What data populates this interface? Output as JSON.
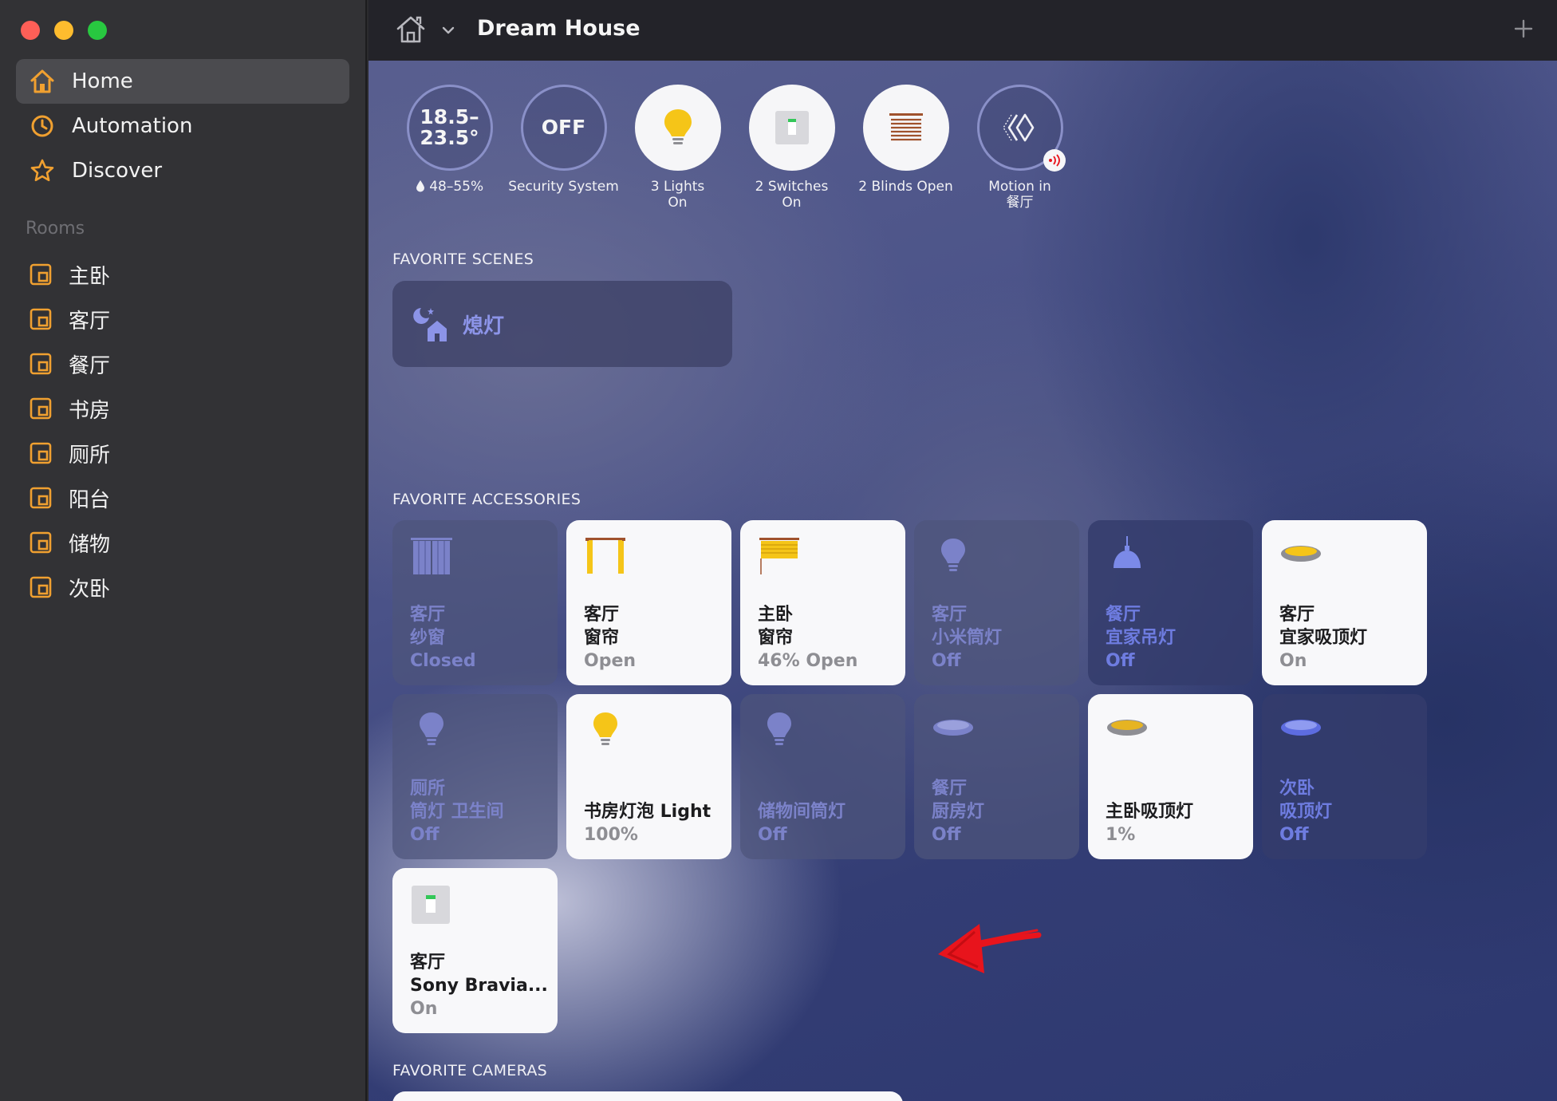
{
  "sidebar": {
    "nav": [
      {
        "label": "Home",
        "icon": "house-icon"
      },
      {
        "label": "Automation",
        "icon": "clock-icon"
      },
      {
        "label": "Discover",
        "icon": "star-icon"
      }
    ],
    "rooms_header": "Rooms",
    "rooms": [
      "主卧",
      "客厅",
      "餐厅",
      "书房",
      "厕所",
      "阳台",
      "储物",
      "次卧"
    ]
  },
  "titlebar": {
    "title": "Dream House"
  },
  "status": {
    "climate": {
      "value": "18.5–\n23.5°",
      "label": "48–55%"
    },
    "security": {
      "value": "OFF",
      "label": "Security System"
    },
    "lights": {
      "label": "3 Lights\nOn"
    },
    "switches": {
      "label": "2 Switches\nOn"
    },
    "blinds": {
      "label": "2 Blinds Open"
    },
    "motion": {
      "label": "Motion in\n餐厅"
    }
  },
  "scenes": {
    "header": "FAVORITE SCENES",
    "items": [
      {
        "label": "熄灯"
      }
    ]
  },
  "accessories": {
    "header": "FAVORITE ACCESSORIES",
    "tiles": [
      {
        "name": "客厅\n纱窗",
        "state": "Closed",
        "on": false,
        "icon": "curtain-closed-icon"
      },
      {
        "name": "客厅\n窗帘",
        "state": "Open",
        "on": true,
        "icon": "curtain-open-icon"
      },
      {
        "name": "主卧\n窗帘",
        "state": "46% Open",
        "on": true,
        "icon": "blinds-icon"
      },
      {
        "name": "客厅\n小米筒灯",
        "state": "Off",
        "on": false,
        "icon": "bulb-icon"
      },
      {
        "name": "餐厅\n宜家吊灯",
        "state": "Off",
        "on": false,
        "icon": "pendant-lamp-icon"
      },
      {
        "name": "客厅\n宜家吸顶灯",
        "state": "On",
        "on": true,
        "icon": "ceiling-light-icon"
      },
      {
        "name": "厕所\n筒灯 卫生间",
        "state": "Off",
        "on": false,
        "icon": "bulb-icon"
      },
      {
        "name": "书房灯泡 Light",
        "state": "100%",
        "on": true,
        "icon": "bulb-icon"
      },
      {
        "name": "储物间筒灯",
        "state": "Off",
        "on": false,
        "icon": "bulb-icon"
      },
      {
        "name": "餐厅\n厨房灯",
        "state": "Off",
        "on": false,
        "icon": "ceiling-light-icon"
      },
      {
        "name": "主卧吸顶灯",
        "state": "1%",
        "on": true,
        "icon": "ceiling-light-icon"
      },
      {
        "name": "次卧\n吸顶灯",
        "state": "Off",
        "on": false,
        "icon": "ceiling-light-icon"
      },
      {
        "name": "客厅\nSony Bravia...",
        "state": "On",
        "on": true,
        "icon": "switch-icon"
      }
    ]
  },
  "cameras": {
    "header": "FAVORITE CAMERAS"
  },
  "colors": {
    "accent_orange": "#f0a030",
    "on_yellow": "#f5c518",
    "off_purple": "#7b82c9",
    "annotation_red": "#e8141c"
  }
}
